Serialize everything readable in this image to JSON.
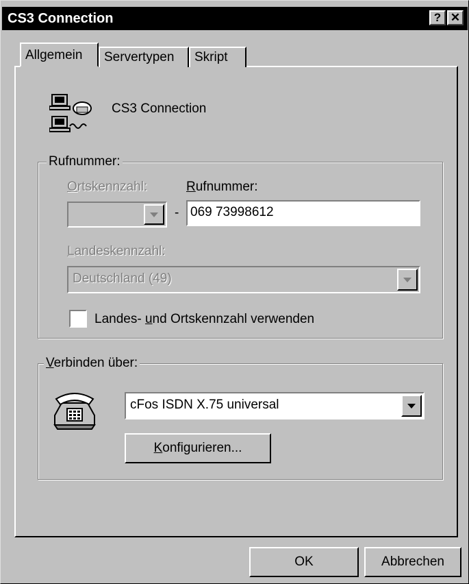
{
  "window": {
    "title": "CS3 Connection",
    "help_glyph": "?",
    "close_glyph": "✕"
  },
  "tabs": [
    {
      "label": "Allgemein",
      "active": true
    },
    {
      "label": "Servertypen",
      "active": false
    },
    {
      "label": "Skript",
      "active": false
    }
  ],
  "connection": {
    "name": "CS3 Connection"
  },
  "rufnummer_group": {
    "legend": "Rufnummer:",
    "area_code": {
      "label_hotkey": "O",
      "label_rest": "rtskennzahl:",
      "value": "",
      "enabled": false
    },
    "separator": "-",
    "number": {
      "label_hotkey": "R",
      "label_rest": "ufnummer:",
      "value": "069 73998612"
    },
    "country": {
      "label_hotkey": "L",
      "label_rest": "andeskennzahl:",
      "value": "Deutschland (49)",
      "enabled": false
    },
    "use_codes": {
      "label_pre": "Landes- ",
      "label_hotkey": "u",
      "label_post": "nd Ortskennzahl verwenden",
      "checked": false
    }
  },
  "verbinden_group": {
    "legend_hotkey": "V",
    "legend_rest": "erbinden über:",
    "device": "cFos ISDN X.75 universal",
    "configure_hotkey": "K",
    "configure_rest": "onfigurieren..."
  },
  "footer": {
    "ok_label": "OK",
    "cancel_label": "Abbrechen"
  },
  "colors": {
    "face": "#c0c0c0",
    "title_bar": "#000000",
    "disabled_text": "#808080"
  }
}
